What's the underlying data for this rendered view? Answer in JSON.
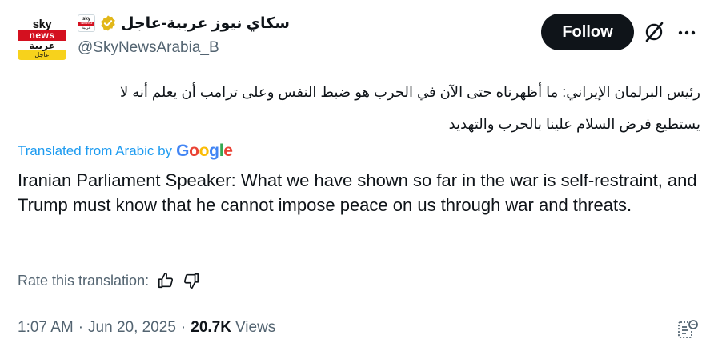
{
  "header": {
    "display_name": "سكاي نيوز عربية-عاجل",
    "handle": "@SkyNewsArabia_B",
    "avatar": {
      "line1": "sky",
      "line2": "news",
      "line3": "عربية",
      "line4": "عاجل"
    },
    "affiliate_badge": {
      "line1": "sky",
      "line2": "NEWS",
      "line3": "عربية"
    },
    "verified_icon": "gold-verified-icon",
    "follow_label": "Follow",
    "grok_icon": "grok-icon",
    "more_icon": "more-icon"
  },
  "post": {
    "original_line1": "رئيس البرلمان الإيراني: ما أظهرناه حتى الآن في الحرب هو ضبط النفس وعلى ترامب أن يعلم أنه لا",
    "original_line2": "يستطيع فرض السلام علينا بالحرب والتهديد",
    "translated_from": "Translated from Arabic by",
    "translator_brand": [
      "G",
      "o",
      "o",
      "g",
      "l",
      "e"
    ],
    "translation": "Iranian Parliament Speaker: What we have shown so far in the war is self-restraint, and Trump must know that he cannot impose peace on us through war and threats."
  },
  "rating": {
    "label": "Rate this translation:",
    "thumbs_up_icon": "thumbs-up-icon",
    "thumbs_down_icon": "thumbs-down-icon"
  },
  "meta": {
    "time": "1:07 AM",
    "separator": "·",
    "date": "Jun 20, 2025",
    "views_count": "20.7K",
    "views_label": "Views",
    "analytics_icon": "analytics-icon"
  },
  "colors": {
    "text_primary": "#0f1419",
    "text_secondary": "#536471",
    "link_blue": "#1d9bf0",
    "verified_gold": "#e2b719",
    "brand_red": "#d4101f",
    "brand_yellow": "#f7d21c"
  }
}
